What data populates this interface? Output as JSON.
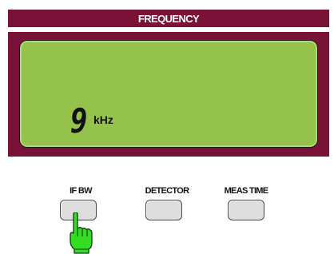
{
  "panel": {
    "title": "FREQUENCY"
  },
  "display": {
    "value": "9",
    "unit": "kHz"
  },
  "softkeys": [
    {
      "label": "IF BW"
    },
    {
      "label": "DETECTOR"
    },
    {
      "label": "MEAS TIME"
    }
  ],
  "pointer": {
    "icon": "pointing-hand-icon",
    "target": "IF BW"
  },
  "colors": {
    "panel": "#7a1238",
    "lcd": "#94c24a",
    "key": "#dedede",
    "hand": "#33dd22"
  }
}
